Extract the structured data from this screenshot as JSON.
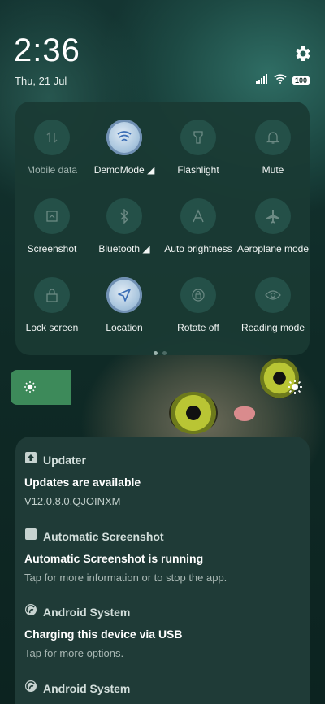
{
  "status_bar": {
    "time": "2:36",
    "date": "Thu, 21 Jul",
    "battery": "100"
  },
  "quick_settings": {
    "tiles": [
      {
        "label": "Mobile data",
        "icon": "mobile-data-icon",
        "active": false
      },
      {
        "label": "DemoMode",
        "icon": "demo-mode-icon",
        "active": true
      },
      {
        "label": "Flashlight",
        "icon": "flashlight-icon",
        "active": false
      },
      {
        "label": "Mute",
        "icon": "bell-icon",
        "active": false
      },
      {
        "label": "Screenshot",
        "icon": "screenshot-icon",
        "active": false
      },
      {
        "label": "Bluetooth",
        "icon": "bluetooth-icon",
        "active": false
      },
      {
        "label": "Auto brightness",
        "icon": "auto-brightness-icon",
        "active": false
      },
      {
        "label": "Aeroplane mode",
        "icon": "airplane-icon",
        "active": false
      },
      {
        "label": "Lock screen",
        "icon": "lock-icon",
        "active": false
      },
      {
        "label": "Location",
        "icon": "location-icon",
        "active": true
      },
      {
        "label": "Rotate off",
        "icon": "rotate-lock-icon",
        "active": false
      },
      {
        "label": "Reading mode",
        "icon": "eye-icon",
        "active": false
      }
    ],
    "page_count": 2,
    "current_page": 1
  },
  "brightness": {
    "level": 0.2
  },
  "notifications": [
    {
      "app": "Updater",
      "title": "Updates are available",
      "text": "V12.0.8.0.QJOINXM"
    },
    {
      "app": "Automatic Screenshot",
      "title": "Automatic Screenshot is running",
      "text": "Tap for more information or to stop the app."
    },
    {
      "app": "Android System",
      "title": "Charging this device via USB",
      "text": "Tap for more options."
    },
    {
      "app": "Android System",
      "title": "",
      "text": ""
    }
  ],
  "colors": {
    "accent_green": "#3d8a5a",
    "active_tile": "#aac6de",
    "panel_bg": "#1a3a34"
  }
}
